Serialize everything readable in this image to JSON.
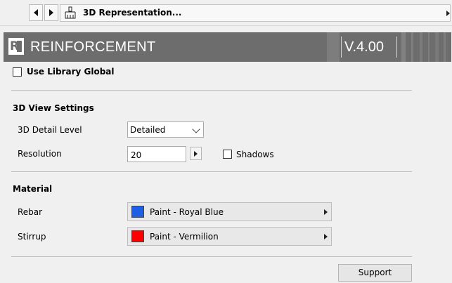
{
  "nav": {
    "title": "3D Representation...",
    "back_icon": "chevron-left-icon",
    "forward_icon": "chevron-right-icon",
    "section_icon": "brush-icon"
  },
  "banner": {
    "logo": "RE",
    "title": "REINFORCEMENT",
    "version": "V.4.00",
    "colors": {
      "background": "#6d6d6d",
      "text": "#ffffff"
    }
  },
  "library": {
    "label": "Use Library Global",
    "checked": false
  },
  "view_settings": {
    "heading": "3D View Settings",
    "detail_level": {
      "label": "3D Detail Level",
      "value": "Detailed"
    },
    "resolution": {
      "label": "Resolution",
      "value": "20"
    },
    "shadows": {
      "label": "Shadows",
      "checked": false
    }
  },
  "material": {
    "heading": "Material",
    "rebar": {
      "label": "Rebar",
      "value": "Paint - Royal Blue",
      "color": "#1e5ee6"
    },
    "stirrup": {
      "label": "Stirrup",
      "value": "Paint - Vermilion",
      "color": "#ff0000"
    }
  },
  "support": {
    "label": "Support"
  }
}
